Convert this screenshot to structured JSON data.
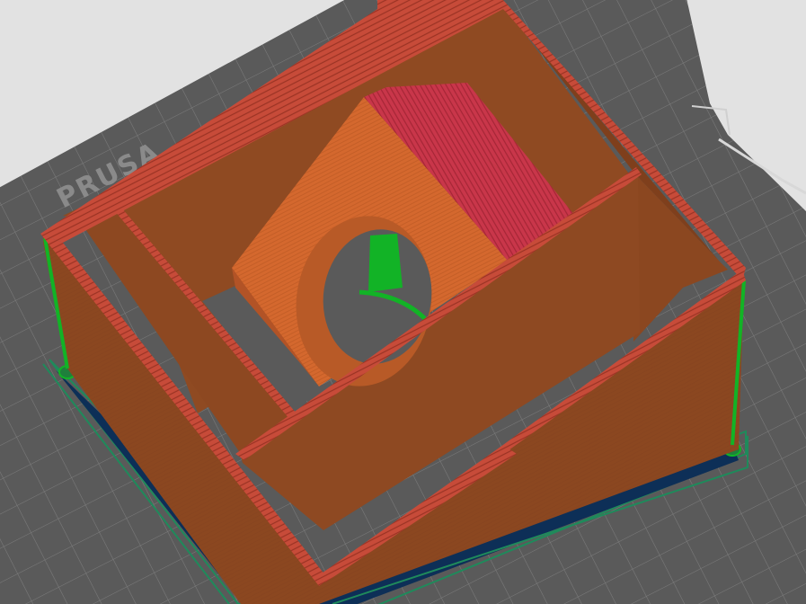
{
  "viewport": {
    "bed_logo_text": "PRUSA"
  },
  "colors": {
    "background": "#e2e2e2",
    "bed_plate": "#5a5a5a",
    "bed_grid_line": "#7c7c7c",
    "bed_logo": "#8a8a8a",
    "wall_orange": "#8b4720",
    "wall_orange_light": "#9a5024",
    "solid_infill_orange": "#d4682e",
    "top_perimeter_red": "#c74b39",
    "internal_fill_red": "#c9364a",
    "support_green": "#12b326",
    "skirt_green": "#1f8a5b",
    "brim_dark_blue": "#0d2f57"
  }
}
